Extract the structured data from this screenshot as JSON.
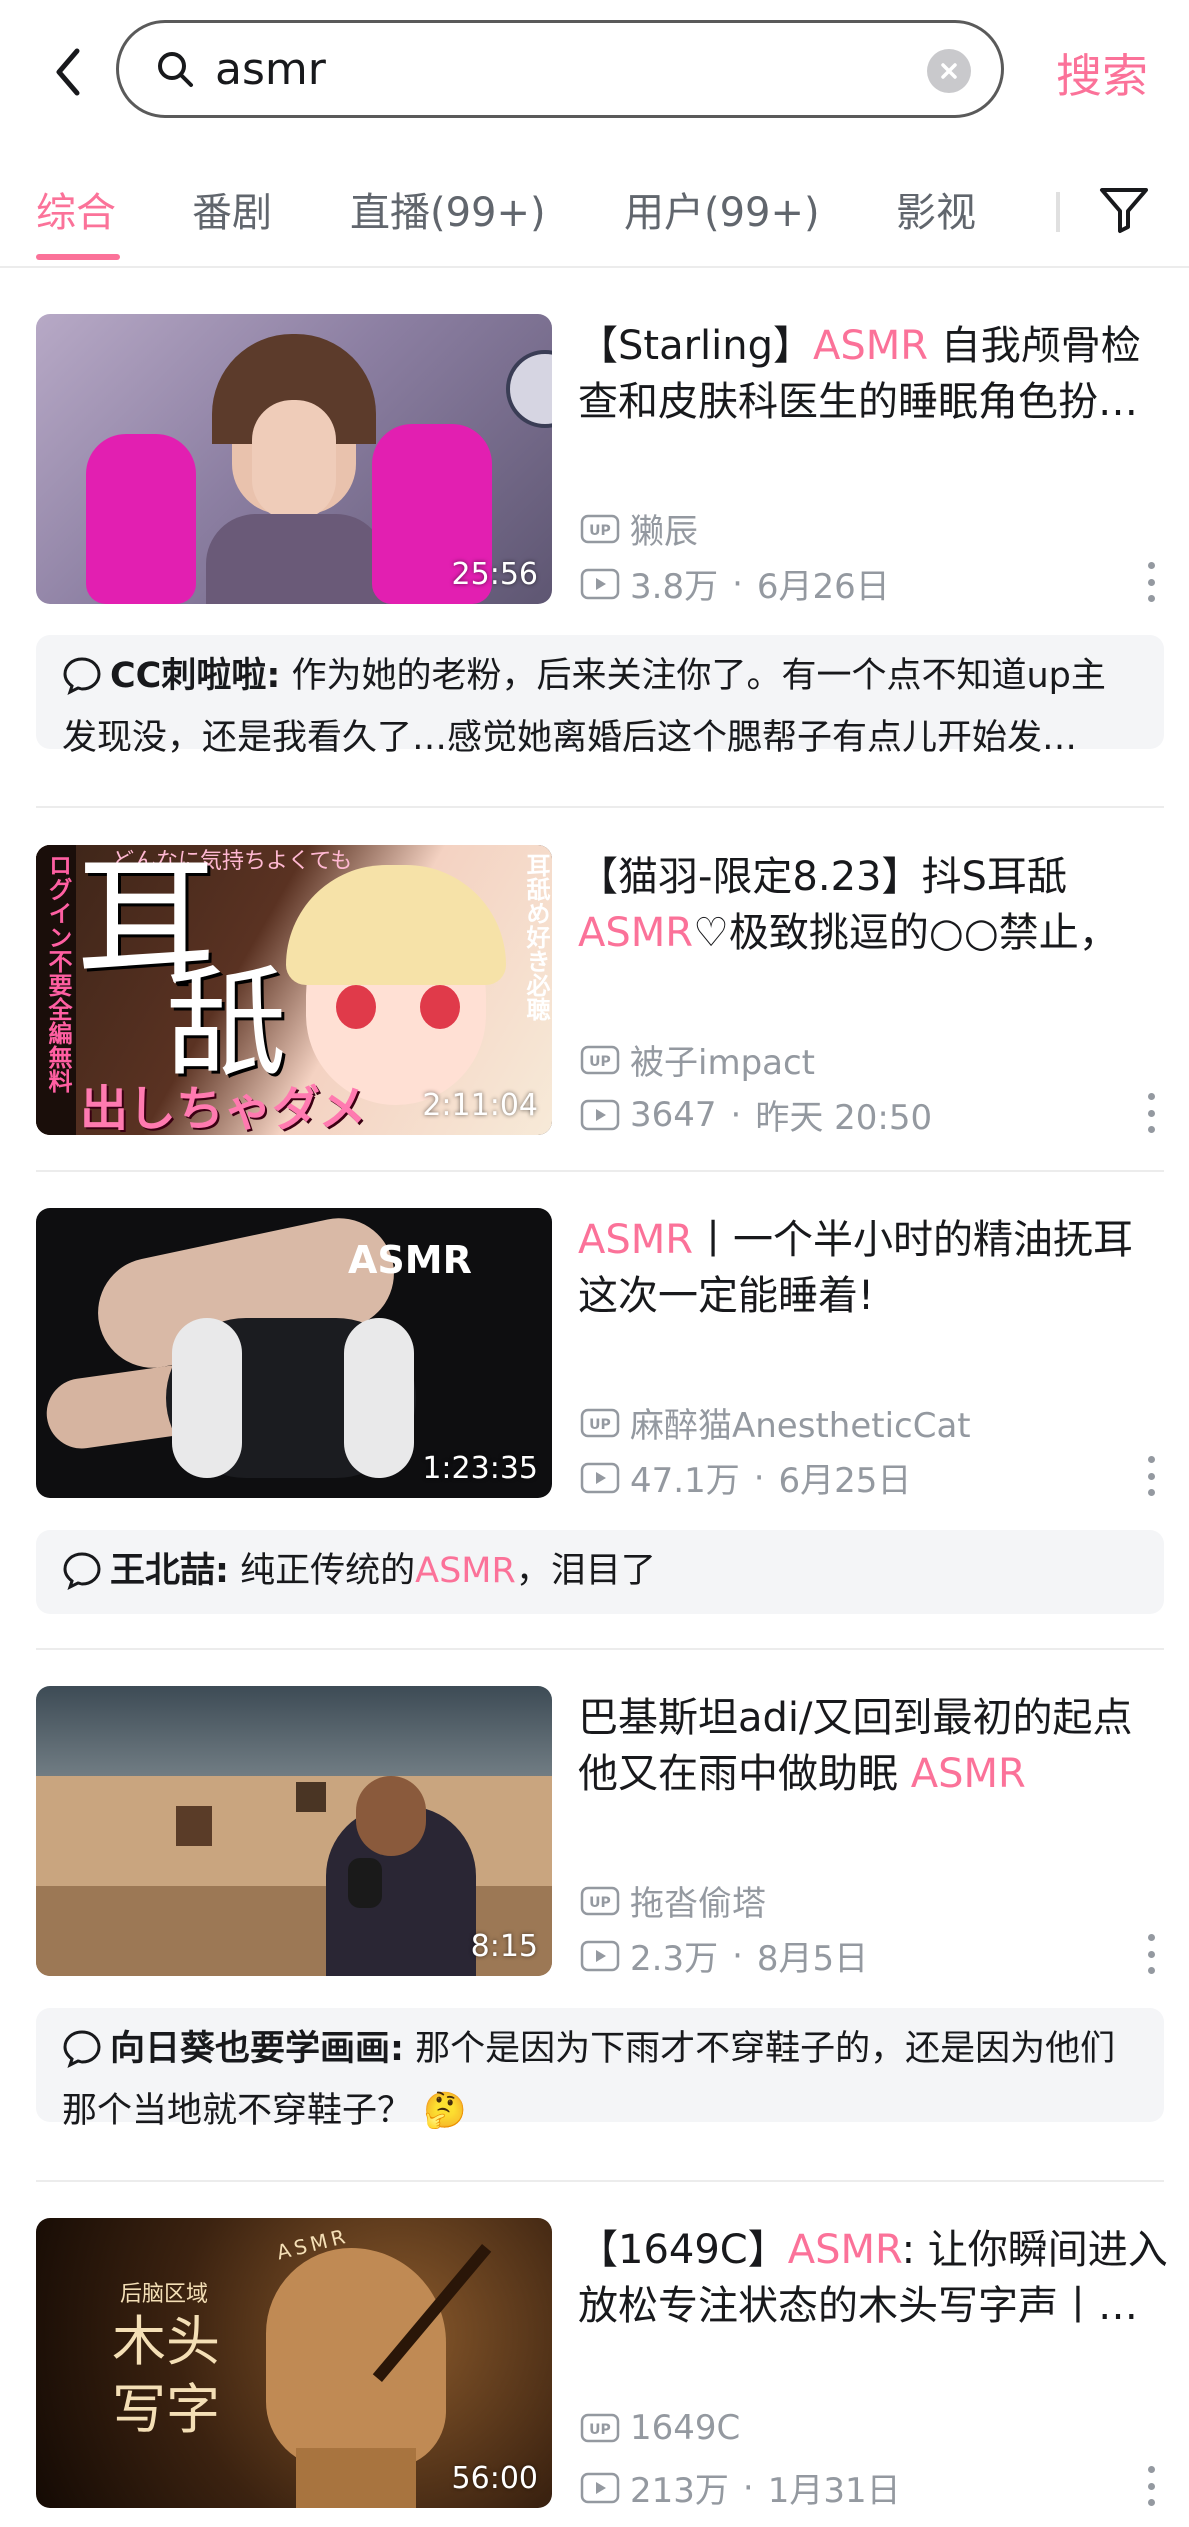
{
  "search": {
    "query": "asmr",
    "button_label": "搜索"
  },
  "tabs": [
    {
      "label": "综合",
      "active": true
    },
    {
      "label": "番剧"
    },
    {
      "label": "直播(99+)"
    },
    {
      "label": "用户(99+)"
    },
    {
      "label": "影视"
    }
  ],
  "colors": {
    "accent": "#fb7299",
    "text": "#18191c",
    "muted": "#9499a0"
  },
  "videos": [
    {
      "title_parts": [
        "【Starling】",
        "ASMR",
        " 自我颅骨检查和皮肤科医生的睡眠角色扮…"
      ],
      "uploader": "獭辰",
      "views": "3.8万",
      "date": "6月26日",
      "duration": "25:56",
      "comment": {
        "user": "CC刺啦啦:",
        "text": " 作为她的老粉，后来关注你了。有一个点不知道up主发现没，还是我看久了…感觉她离婚后这个腮帮子有点儿开始发…"
      }
    },
    {
      "title_parts": [
        "【猫羽-限定8.23】抖S耳舐",
        "ASMR",
        "♡极致挑逗的○○禁止，"
      ],
      "uploader": "被子impact",
      "views": "3647",
      "date": "昨天 20:50",
      "duration": "2:11:04",
      "thumb_text": {
        "big1": "耳",
        "big2": "舐",
        "left": "ログイン不要全編無料",
        "top": "どんなに気持ちよくても",
        "right": "耳舐め好き必聴",
        "bottom": "出しちゃダメ"
      }
    },
    {
      "title_parts": [
        "",
        "ASMR",
        "丨一个半小时的精油抚耳这次一定能睡着!"
      ],
      "uploader": "麻醉猫AnestheticCat",
      "views": "47.1万",
      "date": "6月25日",
      "duration": "1:23:35",
      "thumb_text": {
        "label": "ASMR"
      },
      "comment": {
        "user": "王北喆:",
        "text_before": " 纯正传统的",
        "highlight": "ASMR",
        "text_after": "，泪目了"
      }
    },
    {
      "title_parts": [
        "巴基斯坦adi/又回到最初的起点他又在雨中做助眠 ",
        "ASMR",
        ""
      ],
      "uploader": "拖沓偷塔",
      "views": "2.3万",
      "date": "8月5日",
      "duration": "8:15",
      "comment": {
        "user": "向日葵也要学画画:",
        "text": " 那个是因为下雨才不穿鞋子的，还是因为他们那个当地就不穿鞋子？",
        "emoji": "🤔"
      }
    },
    {
      "title_parts": [
        "【1649C】",
        "ASMR",
        ": 让你瞬间进入放松专注状态的木头写字声丨…"
      ],
      "uploader": "1649C",
      "views": "213万",
      "date": "1月31日",
      "duration": "56:00",
      "thumb_text": {
        "small": "后脑区域",
        "big1": "木头",
        "big2": "写字",
        "arc": "ASMR"
      }
    }
  ]
}
